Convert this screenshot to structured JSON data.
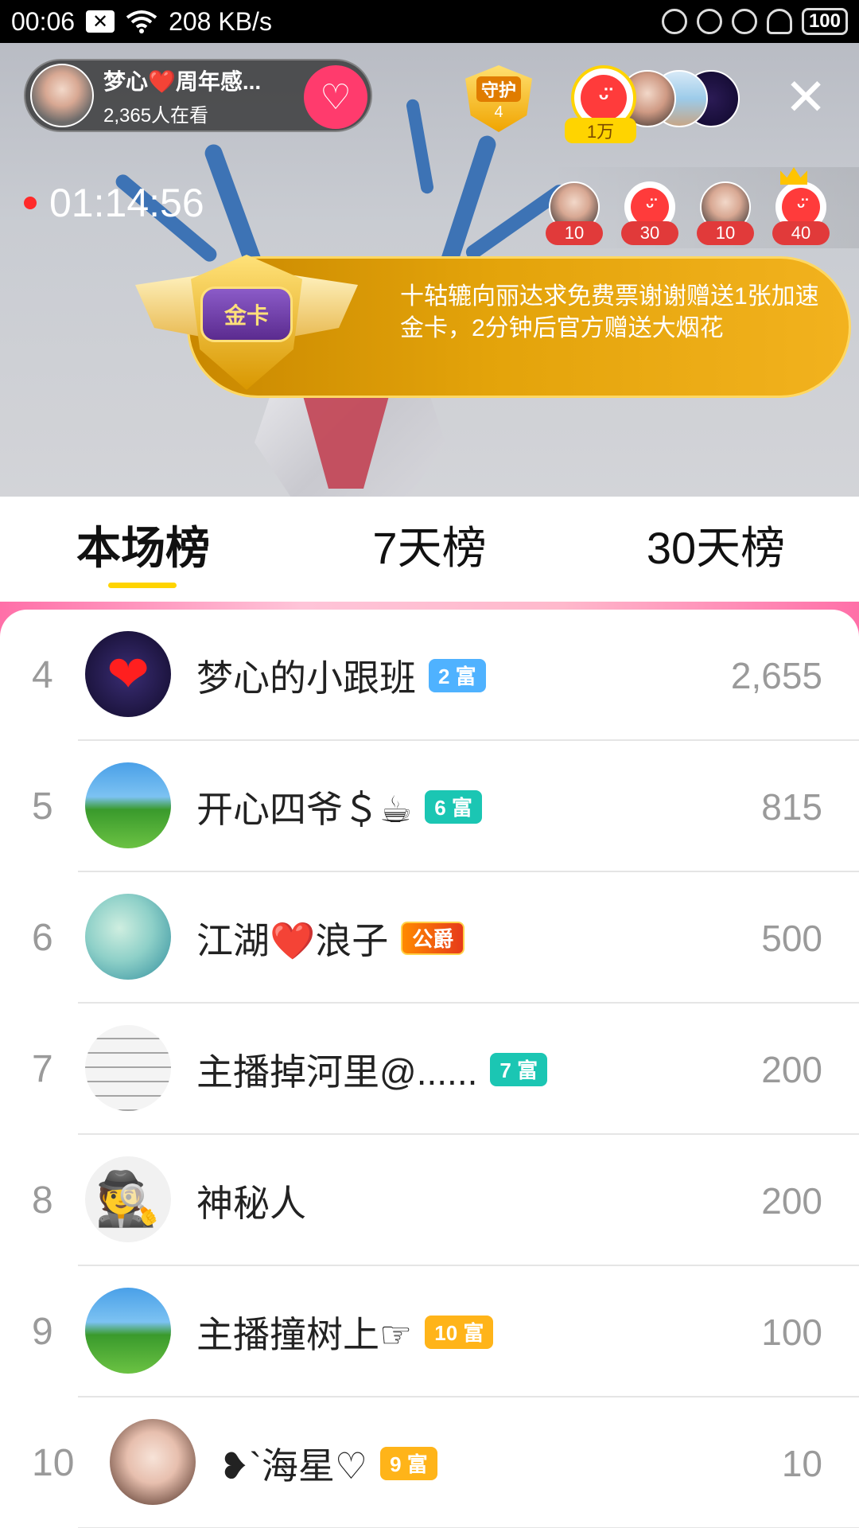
{
  "status_bar": {
    "time": "00:06",
    "speed": "208 KB/s",
    "battery": "100"
  },
  "stream": {
    "host_name": "梦心❤️周年感...",
    "viewers": "2,365人在看",
    "guard_label": "守护",
    "guard_count": "4",
    "top_fan_tag": "1万",
    "timer": "01:14:56",
    "viewer_counts": [
      "10",
      "30",
      "10",
      "40"
    ],
    "gift_card_label": "金卡",
    "gift_message": "十轱辘向丽达求免费票谢谢赠送1张加速金卡，2分钟后官方赠送大烟花"
  },
  "tabs": [
    {
      "label": "本场榜"
    },
    {
      "label": "7天榜"
    },
    {
      "label": "30天榜"
    }
  ],
  "ranking": [
    {
      "rank": "4",
      "name": "梦心的小跟班",
      "badge": "2 富",
      "badge_color": "#4fb2ff",
      "score": "2,655",
      "avatar": "heart-avatar"
    },
    {
      "rank": "5",
      "name": "开心四爷＄☕",
      "badge": "6 富",
      "badge_color": "#1bc6b3",
      "score": "815",
      "avatar": "grass-avatar"
    },
    {
      "rank": "6",
      "name": "江湖❤️浪子",
      "badge": "公爵",
      "badge_color": "#ff5a2a",
      "score": "500",
      "avatar": "dragon-avatar"
    },
    {
      "rank": "7",
      "name": "主播掉河里@......",
      "badge": "7 富",
      "badge_color": "#1bc6b3",
      "score": "200",
      "avatar": "paper-avatar"
    },
    {
      "rank": "8",
      "name": "神秘人",
      "badge": "",
      "badge_color": "",
      "score": "200",
      "avatar": "spy-avatar"
    },
    {
      "rank": "9",
      "name": "主播撞树上☞",
      "badge": "10 富",
      "badge_color": "#ffb419",
      "score": "100",
      "avatar": "grass-avatar"
    },
    {
      "rank": "10",
      "name": "❥`海星♡",
      "badge": "9 富",
      "badge_color": "#ffb419",
      "score": "10",
      "avatar": "girl-avatar"
    }
  ]
}
